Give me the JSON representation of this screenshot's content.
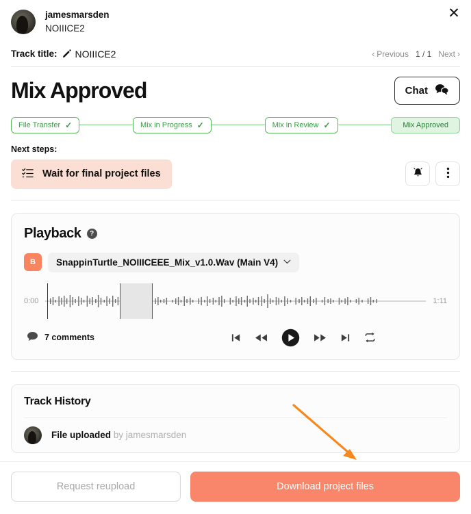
{
  "header": {
    "username": "jamesmarsden",
    "user_subtitle": "NOIIICE2",
    "close_label": "✕"
  },
  "track_title": {
    "label": "Track title:",
    "value": "NOIIICE2",
    "pencil_icon": "pencil-icon"
  },
  "pager": {
    "previous": "Previous",
    "count": "1 / 1",
    "next": "Next",
    "prev_chevron": "‹",
    "next_chevron": "›"
  },
  "page": {
    "title": "Mix Approved",
    "chat_label": "Chat"
  },
  "stepper": {
    "steps": [
      {
        "label": "File Transfer",
        "done": true,
        "check": "✓"
      },
      {
        "label": "Mix in Progress",
        "done": true,
        "check": "✓"
      },
      {
        "label": "Mix in Review",
        "done": true,
        "check": "✓"
      },
      {
        "label": "Mix Approved",
        "done": false,
        "check": ""
      }
    ],
    "active_color": "#3a9a46",
    "current_bg": "#dff5e2"
  },
  "next_steps": {
    "label": "Next steps:",
    "item": "Wait for final project files",
    "item_bg": "#fbdfd4",
    "list_icon": "checklist-icon",
    "bell_icon": "bell-icon",
    "menu_icon": "kebab-menu-icon"
  },
  "playback": {
    "title": "Playback",
    "help_glyph": "?",
    "file_badge": "B",
    "file_name": "SnappinTurtle_NOIIICEEE_Mix_v1.0.Wav (Main V4)",
    "caret": "⌄",
    "time_start": "0:00",
    "time_end": "1:11",
    "comments_count": "7 comments",
    "controls": [
      "skip-start-icon",
      "rewind-icon",
      "play-icon",
      "fast-forward-icon",
      "skip-end-icon",
      "loop-icon"
    ]
  },
  "track_history": {
    "title": "Track History",
    "entries": [
      {
        "action": "File uploaded",
        "by": " by jamesmarsden"
      }
    ]
  },
  "annotation": {
    "arrow_color": "#F5891F",
    "points_to": "download-project-files-button"
  },
  "bottom_bar": {
    "secondary_label": "Request reupload",
    "primary_label": "Download project files",
    "primary_color": "#f9866a"
  }
}
